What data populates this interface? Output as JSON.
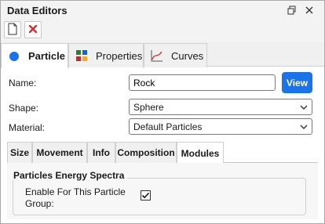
{
  "window": {
    "title": "Data Editors"
  },
  "titlebar_icons": [
    "restore-icon",
    "close-icon"
  ],
  "toolbar": {
    "buttons": [
      "new-document-icon",
      "delete-icon"
    ]
  },
  "top_tabs": [
    {
      "label": "Particle",
      "icon": "particle-icon",
      "active": true
    },
    {
      "label": "Properties",
      "icon": "properties-icon",
      "active": false
    },
    {
      "label": "Curves",
      "icon": "curves-icon",
      "active": false
    }
  ],
  "form": {
    "name_label": "Name:",
    "name_value": "Rock",
    "view_label": "View",
    "shape_label": "Shape:",
    "shape_value": "Sphere",
    "material_label": "Material:",
    "material_value": "Default Particles"
  },
  "sub_tabs": [
    {
      "label": "Size",
      "active": false
    },
    {
      "label": "Movement",
      "active": false
    },
    {
      "label": "Info",
      "active": false
    },
    {
      "label": "Composition",
      "active": false
    },
    {
      "label": "Modules",
      "active": true
    }
  ],
  "modules": {
    "group_title": "Particles Energy Spectra",
    "checkbox_label": "Enable For This Particle Group:",
    "checkbox_checked": true
  },
  "colors": {
    "accent": "#1a73e8",
    "delete": "#d32f2f",
    "particle_dot": "#1a73e8"
  }
}
